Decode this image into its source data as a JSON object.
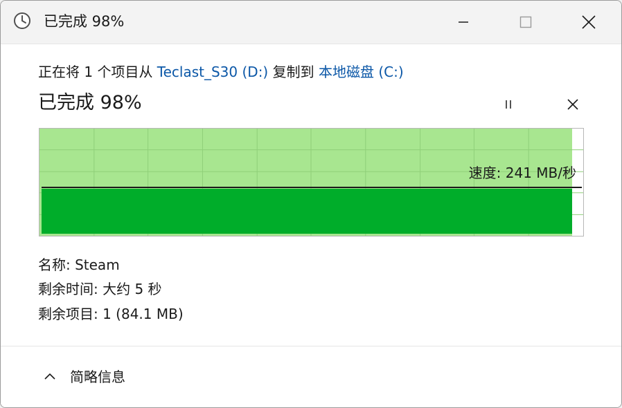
{
  "window": {
    "title": "已完成 98%",
    "icon": "clock-icon"
  },
  "copy": {
    "prefix": "正在将 1 个项目从 ",
    "source": "Teclast_S30 (D:)",
    "middle": " 复制到 ",
    "destination": "本地磁盘 (C:)",
    "progress_label": "已完成 98%",
    "progress": 0.98,
    "speed_label": "速度: 241 MB/秒"
  },
  "details": {
    "name": "名称: Steam",
    "time_remaining": "剩余时间: 大约 5 秒",
    "items_remaining": "剩余项目: 1 (84.1 MB)"
  },
  "footer": {
    "less_details": "简略信息"
  },
  "colors": {
    "link": "#0b57a7",
    "progress_fill": "#a8e690",
    "speed_fill": "#00ad2a"
  }
}
